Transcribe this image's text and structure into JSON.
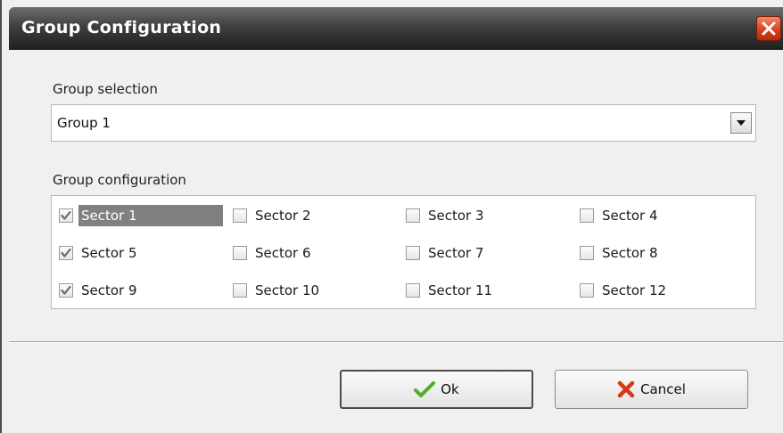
{
  "window": {
    "title": "Group Configuration"
  },
  "group_selection": {
    "label": "Group selection",
    "value": "Group 1"
  },
  "group_configuration": {
    "label": "Group configuration",
    "sectors": [
      {
        "label": "Sector 1",
        "checked": true,
        "focused": true
      },
      {
        "label": "Sector 2",
        "checked": false
      },
      {
        "label": "Sector 3",
        "checked": false
      },
      {
        "label": "Sector 4",
        "checked": false
      },
      {
        "label": "Sector 5",
        "checked": true
      },
      {
        "label": "Sector 6",
        "checked": false
      },
      {
        "label": "Sector 7",
        "checked": false
      },
      {
        "label": "Sector 8",
        "checked": false
      },
      {
        "label": "Sector 9",
        "checked": true
      },
      {
        "label": "Sector 10",
        "checked": false
      },
      {
        "label": "Sector 11",
        "checked": false
      },
      {
        "label": "Sector 12",
        "checked": false
      }
    ]
  },
  "buttons": {
    "ok_label": "Ok",
    "cancel_label": "Cancel"
  },
  "icons": {
    "close": "close-icon",
    "dropdown": "chevron-down-icon",
    "ok": "checkmark-icon",
    "cancel": "x-mark-icon"
  },
  "colors": {
    "titlebar": "#2e2e2e",
    "close_button": "#d8431f",
    "focus_highlight": "#808080",
    "ok_check": "#4caf2a",
    "cancel_x": "#d33a1a"
  }
}
